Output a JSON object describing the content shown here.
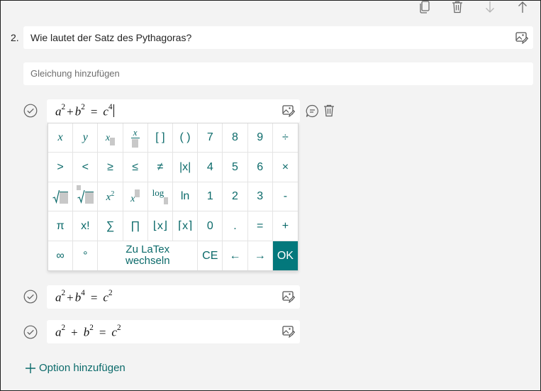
{
  "toolbar": {
    "icons": [
      "copy-icon",
      "trash-icon",
      "arrow-down-icon",
      "arrow-up-icon"
    ]
  },
  "question": {
    "number": "2.",
    "text": "Wie lautet der Satz des Pythagoras?",
    "equation_placeholder": "Gleichung hinzufügen"
  },
  "options": [
    {
      "base1": "a",
      "exp1": "2",
      "base2": "b",
      "exp2": "2",
      "base3": "c",
      "exp3": "4",
      "editing": true
    },
    {
      "base1": "a",
      "exp1": "2",
      "base2": "b",
      "exp2": "4",
      "base3": "c",
      "exp3": "2",
      "editing": false
    },
    {
      "base1": "a",
      "exp1": "2",
      "base2": "b",
      "exp2": "2",
      "base3": "c",
      "exp3": "2",
      "editing": false
    }
  ],
  "operators": {
    "plus": "+",
    "equals": "="
  },
  "keypad": {
    "row1": [
      "x",
      "y",
      "",
      "",
      "[ ]",
      "( )",
      "7",
      "8",
      "9",
      "÷"
    ],
    "row2": [
      ">",
      "<",
      "≥",
      "≤",
      "≠",
      "|x|",
      "4",
      "5",
      "6",
      "×"
    ],
    "row3": [
      "",
      "",
      "",
      "",
      "log",
      "ln",
      "1",
      "2",
      "3",
      "-"
    ],
    "row4": [
      "π",
      "x!",
      "∑",
      "∏",
      "⌊x⌋",
      "⌈x⌉",
      "0",
      ".",
      "=",
      "+"
    ],
    "row5": [
      "∞",
      "°",
      "Zu LaTex wechseln",
      "CE",
      "←",
      "→",
      "OK"
    ],
    "x_glyph": "x",
    "sq": "2"
  },
  "add_option": "Option hinzufügen",
  "colors": {
    "accent": "#03787c",
    "accent_text": "#0b6a6a"
  }
}
